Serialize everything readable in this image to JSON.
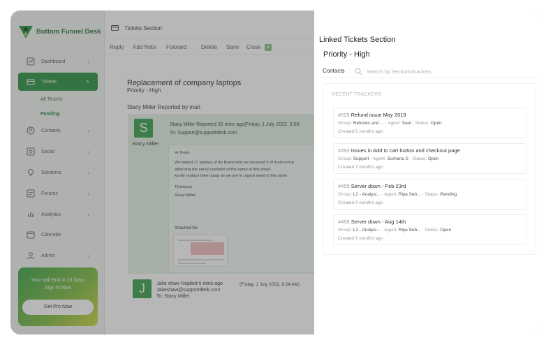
{
  "brand": {
    "name": "Bottom Funnel Desk",
    "color": "#1f8a3a"
  },
  "sidebar": {
    "items": [
      {
        "label": "Dashboard",
        "icon": "chart-icon"
      },
      {
        "label": "Tickets",
        "icon": "ticket-icon",
        "active": true
      },
      {
        "label": "Contacts",
        "icon": "contacts-icon"
      },
      {
        "label": "Social",
        "icon": "social-icon"
      },
      {
        "label": "Solutions",
        "icon": "solutions-icon"
      },
      {
        "label": "Forums",
        "icon": "forums-icon"
      },
      {
        "label": "Analytics",
        "icon": "analytics-icon"
      },
      {
        "label": "Calendar",
        "icon": "calendar-icon"
      },
      {
        "label": "Admin",
        "icon": "admin-icon"
      }
    ],
    "tickets_sub": [
      "All Tickets",
      "Pending"
    ],
    "trial": {
      "line1": "Your trail End in 10 Days",
      "line2": "Sign In Now",
      "button": "Get Pro Now"
    }
  },
  "main": {
    "section_title": "Tickets Section",
    "toolbar": [
      "Reply",
      "Add Note",
      "Forward",
      "Delete",
      "Save",
      "Close"
    ],
    "ticket": {
      "subject": "Replacement of company laptops",
      "priority": "Priority  - High",
      "reporter": "Stacy Miller Reported by mail."
    },
    "message1": {
      "avatar": "S",
      "name": "Stacy Miller",
      "header": "Stacy Miller Reported 35 mins ago(Friday, 1 July 2022, 9.00",
      "to": "To: Support@supportdesk.com",
      "body": [
        "Hi Team,",
        "We baked 17 laptops of Az Brand and we received 5 of them not w",
        "attaching the serial numbers of the same in this email.",
        "kindly replace them asap as we are in urgent need of the same",
        "Thankyou",
        "Stacy Miller"
      ],
      "attached_label": "Attached file"
    },
    "message2": {
      "avatar": "J",
      "header": "Jake shaw Replied 6 mins ago",
      "date": "(Friday, 1 July 2022, 9.24 AM)",
      "email": "Jakeshaw@supportdesk.com",
      "to": "To: Stacy Miller"
    }
  },
  "panel": {
    "title": "Linked Tickets Section",
    "priority": "Priority  - High",
    "contacts_tab": "Contacts",
    "search_placeholder": "Search by Sections/trackers",
    "recent_label": "RECENT TRACKERS",
    "trackers": [
      {
        "num": "#525",
        "title": "Refund issue May 2019",
        "group": "Refunds and ...",
        "agent": "Saul",
        "status": "Open",
        "created": "Created 5 months ago"
      },
      {
        "num": "#493",
        "title": "Issues in Add to cart button and checkout page",
        "group": "Support",
        "agent": "Sumana S",
        "status": "Open",
        "created": "Created 7 months ago"
      },
      {
        "num": "#459",
        "title": "Server down - Feb 23rd",
        "group": "L2 - Analysi...",
        "agent": "Riya Seb...",
        "status": "Pending",
        "created": "Created 9 months ago"
      },
      {
        "num": "#458",
        "title": "Server down - Aug 14th",
        "group": "L2 - Analysi...",
        "agent": "Riya Seb...",
        "status": "Open",
        "created": "Created 9 months ago"
      }
    ],
    "meta_labels": {
      "group": "Group:",
      "agent": "Agent:",
      "status": "Status:"
    }
  }
}
